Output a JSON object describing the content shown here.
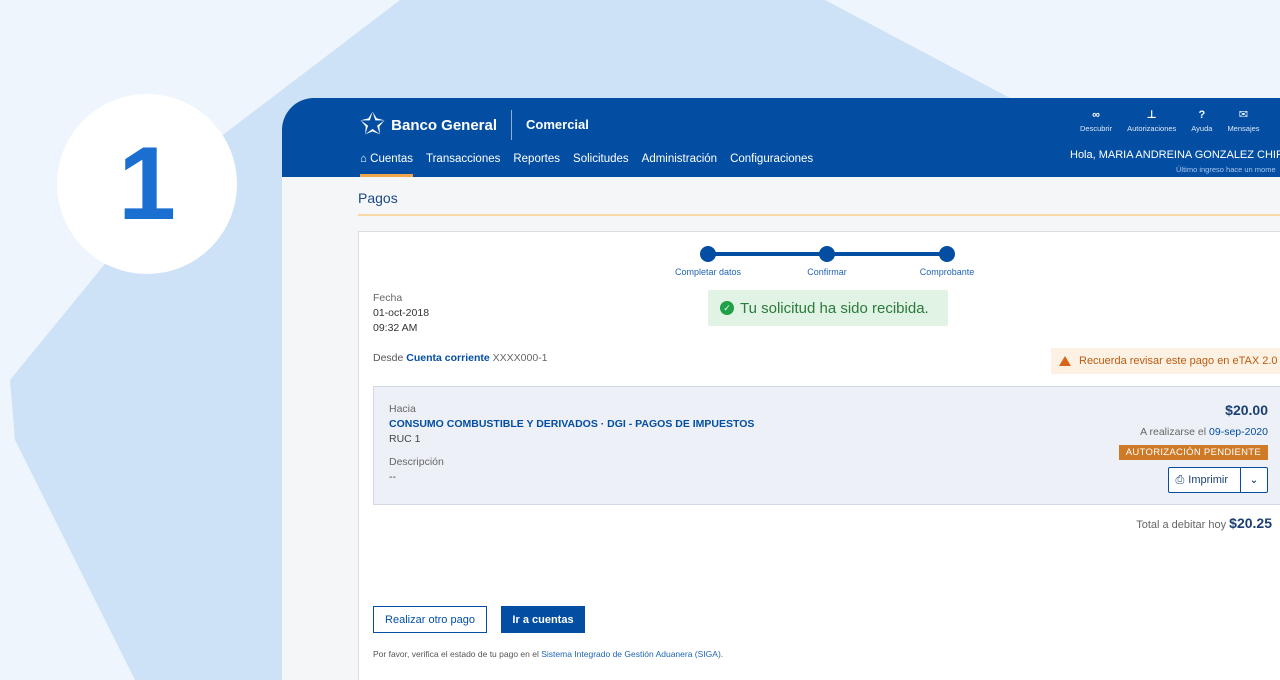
{
  "step": {
    "number": "1"
  },
  "brand": {
    "name": "Banco General",
    "sub": "Comercial"
  },
  "nav": [
    {
      "label": "Cuentas",
      "active": true
    },
    {
      "label": "Transacciones"
    },
    {
      "label": "Reportes"
    },
    {
      "label": "Solicitudes"
    },
    {
      "label": "Administración"
    },
    {
      "label": "Configuraciones"
    }
  ],
  "tools": [
    {
      "label": "Descubrir",
      "icon": "binoculars-icon"
    },
    {
      "label": "Autorizaciones",
      "icon": "org-chart-icon"
    },
    {
      "label": "Ayuda",
      "icon": "question-icon"
    },
    {
      "label": "Mensajes",
      "icon": "envelope-icon"
    }
  ],
  "user": {
    "greeting": "Hola, MARIA ANDREINA GONZALEZ CHIRIN",
    "last_login": "Último ingreso hace un mome"
  },
  "page": {
    "title": "Pagos"
  },
  "stepper": {
    "steps": [
      "Completar datos",
      "Confirmar",
      "Comprobante"
    ]
  },
  "success": {
    "message": "Tu solicitud ha sido recibida."
  },
  "fecha": {
    "label": "Fecha",
    "date": "01-oct-2018",
    "time": "09:32 AM"
  },
  "desde": {
    "label": "Desde",
    "account": "Cuenta corriente",
    "number": "XXXX000-1"
  },
  "warning": {
    "text": "Recuerda revisar este pago en eTAX 2.0"
  },
  "payment": {
    "hacia_label": "Hacia",
    "recipient": "CONSUMO COMBUSTIBLE Y DERIVADOS · DGI - PAGOS DE IMPUESTOS",
    "ruc": "RUC 1",
    "desc_label": "Descripción",
    "desc_value": "--",
    "amount": "$20.00",
    "schedule_prefix": "A realizarse el",
    "schedule_date": "09-sep-2020",
    "status": "AUTORIZACIÓN PENDIENTE",
    "print_label": "Imprimir"
  },
  "total": {
    "label": "Total a debitar hoy",
    "value": "$20.25"
  },
  "actions": {
    "other_payment": "Realizar otro pago",
    "go_accounts": "Ir a cuentas"
  },
  "footnote": {
    "prefix": "Por favor, verifica el estado de tu pago en el",
    "link": "Sistema Integrado de Gestión Aduanera (SIGA)",
    "suffix": "."
  },
  "colors": {
    "primary": "#034ea2",
    "accent": "#f0a649",
    "success_bg": "#e0f3e4",
    "badge": "#cf7a26"
  }
}
